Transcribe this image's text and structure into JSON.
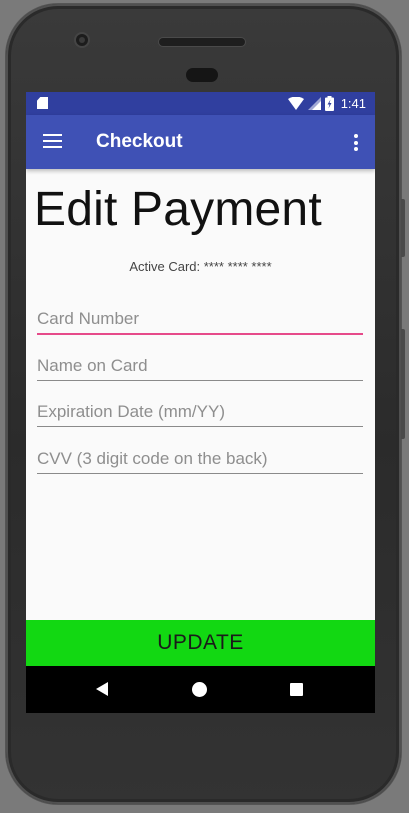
{
  "status_bar": {
    "time": "1:41",
    "icons": [
      "sd-card-icon",
      "wifi-icon",
      "signal-icon",
      "battery-charging-icon"
    ]
  },
  "app_bar": {
    "title": "Checkout",
    "left_icon": "hamburger-menu-icon",
    "right_icon": "overflow-menu-icon"
  },
  "page": {
    "heading": "Edit Payment",
    "active_card_label": "Active Card: **** **** ****"
  },
  "form": {
    "card_number": {
      "value": "",
      "placeholder": "Card Number"
    },
    "name_on_card": {
      "value": "",
      "placeholder": "Name on Card"
    },
    "expiration_date": {
      "value": "",
      "placeholder": "Expiration Date (mm/YY)"
    },
    "cvv": {
      "value": "",
      "placeholder": "CVV (3 digit code on the back)"
    }
  },
  "update_button": {
    "label": "UPDATE"
  },
  "nav_bar": {
    "icons": [
      "back-icon",
      "home-icon",
      "recents-icon"
    ]
  },
  "colors": {
    "status_bar": "#303f9f",
    "app_bar": "#3f51b5",
    "focused_underline": "#e64a8a",
    "update_button": "#12d812",
    "nav_bar": "#000000",
    "screen_background": "#fafafa"
  }
}
